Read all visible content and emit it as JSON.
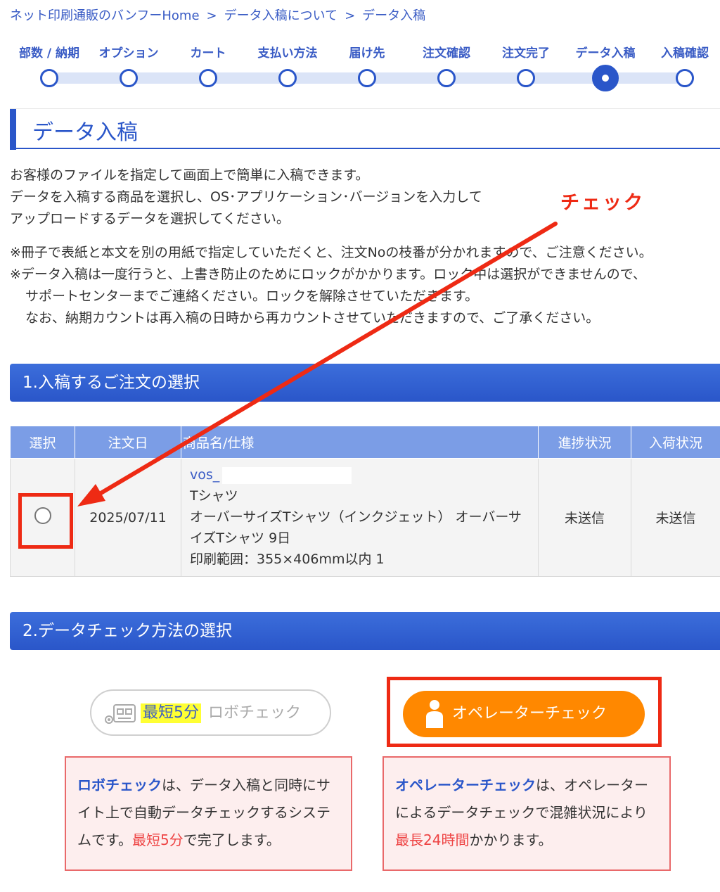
{
  "breadcrumb": {
    "home": "ネット印刷通販のバンフーHome",
    "separator": ">",
    "data_about": "データ入稿について",
    "current": "データ入稿"
  },
  "steps": [
    {
      "label": "部数 / 納期"
    },
    {
      "label": "オプション"
    },
    {
      "label": "カート"
    },
    {
      "label": "支払い方法"
    },
    {
      "label": "届け先"
    },
    {
      "label": "注文確認"
    },
    {
      "label": "注文完了"
    },
    {
      "label": "データ入稿",
      "active": true
    },
    {
      "label": "入稿確認"
    }
  ],
  "page_title": "データ入稿",
  "intro": [
    "お客様のファイルを指定して画面上で簡単に入稿できます。",
    "データを入稿する商品を選択し、OS･アプリケーション･バージョンを入力して",
    "アップロードするデータを選択してください。"
  ],
  "notes": [
    "※冊子で表紙と本文を別の用紙で指定していただくと、注文Noの枝番が分かれますので、ご注意ください。",
    "※データ入稿は一度行うと、上書き防止のためにロックがかかります。ロック中は選択ができませんので、",
    "サポートセンターまでご連絡ください。ロックを解除させていただきます。",
    "なお、納期カウントは再入稿の日時から再カウントさせていただきますので、ご了承ください。"
  ],
  "section1": {
    "title": "1.入稿するご注文の選択"
  },
  "table": {
    "headers": [
      "選択",
      "注文日",
      "商品名/仕様",
      "進捗状況",
      "入荷状況"
    ],
    "row": {
      "order_date": "2025/07/11",
      "product_link": "vos_",
      "spec_lines": [
        "Tシャツ",
        "オーバーサイズTシャツ（インクジェット） オーバーサイズTシャツ 9日",
        "印刷範囲：355×406mm以内 1"
      ],
      "progress": "未送信",
      "arrival": "未送信"
    }
  },
  "section2": {
    "title": "2.データチェック方法の選択"
  },
  "robo_button": {
    "highlight": "最短5分",
    "label": "ロボチェック"
  },
  "operator_button": {
    "label": "オペレーターチェック"
  },
  "robo_desc": {
    "name": "ロボチェック",
    "text1": "は、データ入稿と同時にサイト上で自動データチェックするシステムです。",
    "time": "最短5分",
    "text2": "で完了します。"
  },
  "operator_desc": {
    "name": "オペレーターチェック",
    "text1": "は、オペレーターによるデータチェックで混雑状況により",
    "time": "最長24時間",
    "text2": "かかります。"
  },
  "annotation": {
    "label": "チェック"
  },
  "colors": {
    "brand_blue": "#2a56c9",
    "operator_orange": "#ff8800",
    "annotation_red": "#ee2a14"
  }
}
